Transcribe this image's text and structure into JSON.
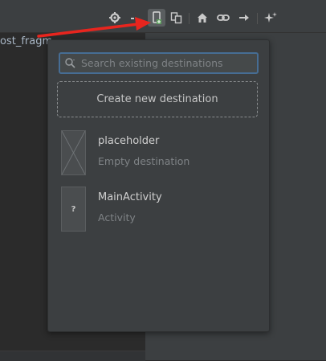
{
  "editor": {
    "fragment_text": "ost_fragm"
  },
  "toolbar": {
    "icons": [
      "gear-icon",
      "minus-icon",
      "new-destination-icon",
      "nested-graph-icon",
      "home-icon",
      "link-icon",
      "action-arrow-icon",
      "auto-arrange-icon"
    ]
  },
  "popup": {
    "search_placeholder": "Search existing destinations",
    "create_label": "Create new destination",
    "destinations": [
      {
        "name": "placeholder",
        "subtitle": "Empty destination",
        "thumb": "placeholder-thumbnail"
      },
      {
        "name": "MainActivity",
        "subtitle": "Activity",
        "thumb": "?"
      }
    ]
  },
  "colors": {
    "accent_focus": "#466d94",
    "annotation_arrow": "#e8251e",
    "highlight_icon": "#5f9e5f"
  }
}
